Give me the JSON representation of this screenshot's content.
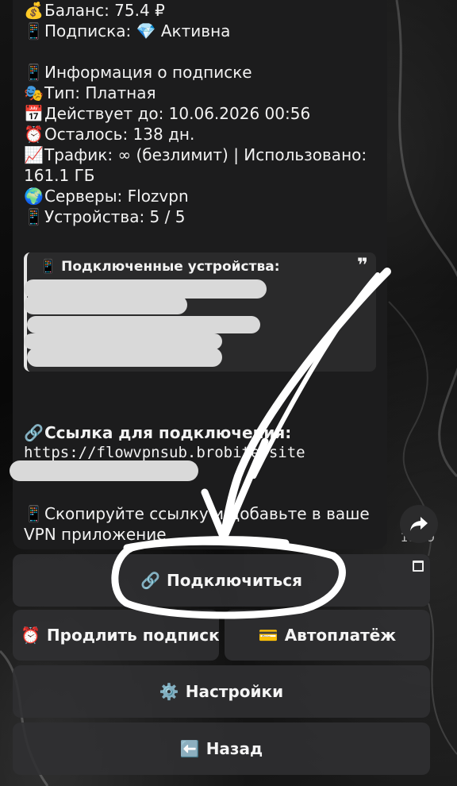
{
  "message": {
    "balance": {
      "emoji": "💰",
      "text": "Баланс: 75.4 ₽"
    },
    "subscription": {
      "emoji": "📱",
      "text": "Подписка: 💎 Активна"
    },
    "info_header": {
      "emoji": "📱",
      "text": "Информация о подписке"
    },
    "type": {
      "emoji": "🎭",
      "text": "Тип: Платная"
    },
    "valid_until": {
      "emoji": "📅",
      "text": "Действует до: 10.06.2026 00:56"
    },
    "remaining": {
      "emoji": "⏰",
      "text": "Осталось: 138 дн."
    },
    "traffic_line1": {
      "emoji": "📈",
      "text": "Трафик: ∞ (безлимит) | Использовано:"
    },
    "traffic_line2": "161.1 ГБ",
    "servers": {
      "emoji": "🌍",
      "text": "Серверы: Flozvpn"
    },
    "devices": {
      "emoji": "📱",
      "text": "Устройства: 5 / 5"
    },
    "quote": {
      "emoji": "📱",
      "title": "Подключенные устройства:",
      "mark": "❞"
    },
    "link_header": {
      "emoji": "🔗",
      "text": "Ссылка для подключения:"
    },
    "link_url": "https://flowvpnsub.brobite.site",
    "instruction_line1": {
      "emoji": "📱",
      "text": "Скопируйте ссылку и добавьте в ваше"
    },
    "instruction_line2": "VPN приложение",
    "time": "18:39"
  },
  "keyboard": {
    "connect": {
      "icon": "🔗",
      "label": "Подключиться"
    },
    "renew": {
      "icon": "⏰",
      "label": "Продлить подписку"
    },
    "autopay": {
      "icon": "💳",
      "label": "Автоплатёж"
    },
    "settings": {
      "icon": "⚙️",
      "label": "Настройки"
    },
    "back": {
      "icon": "⬅️",
      "label": "Назад"
    }
  },
  "icons": {
    "share": "share-arrow-icon",
    "webapp": "window-icon"
  }
}
